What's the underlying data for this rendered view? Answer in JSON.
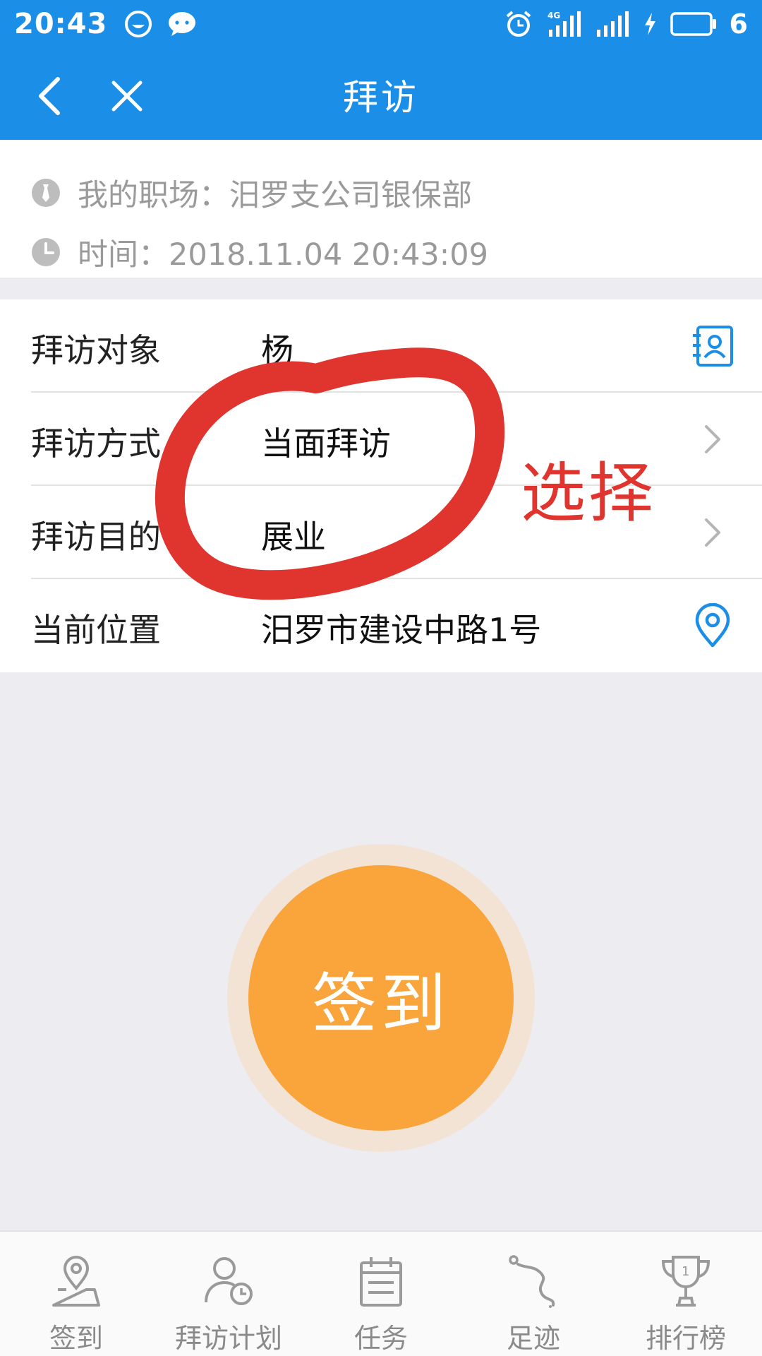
{
  "status_bar": {
    "time": "20:43",
    "battery": "6",
    "network": "4G"
  },
  "header": {
    "title": "拜访"
  },
  "info": {
    "workplace": "我的职场：汨罗支公司银保部",
    "time": "时间：2018.11.04 20:43:09"
  },
  "form": {
    "rows": [
      {
        "label": "拜访对象",
        "value": "杨"
      },
      {
        "label": "拜访方式",
        "value": "当面拜访"
      },
      {
        "label": "拜访目的",
        "value": "展业"
      },
      {
        "label": "当前位置",
        "value": "汨罗市建设中路1号"
      }
    ]
  },
  "annotation": {
    "text": "选择",
    "color": "#e0342e"
  },
  "signin": {
    "label": "签到",
    "color": "#faa53c"
  },
  "tabs": [
    {
      "label": "签到",
      "icon": "location-map-icon"
    },
    {
      "label": "拜访计划",
      "icon": "user-clock-icon"
    },
    {
      "label": "任务",
      "icon": "calendar-task-icon"
    },
    {
      "label": "足迹",
      "icon": "footprint-path-icon"
    },
    {
      "label": "排行榜",
      "icon": "trophy-icon"
    }
  ],
  "theme": {
    "primary": "#1b8fe8",
    "background": "#ededf1"
  }
}
